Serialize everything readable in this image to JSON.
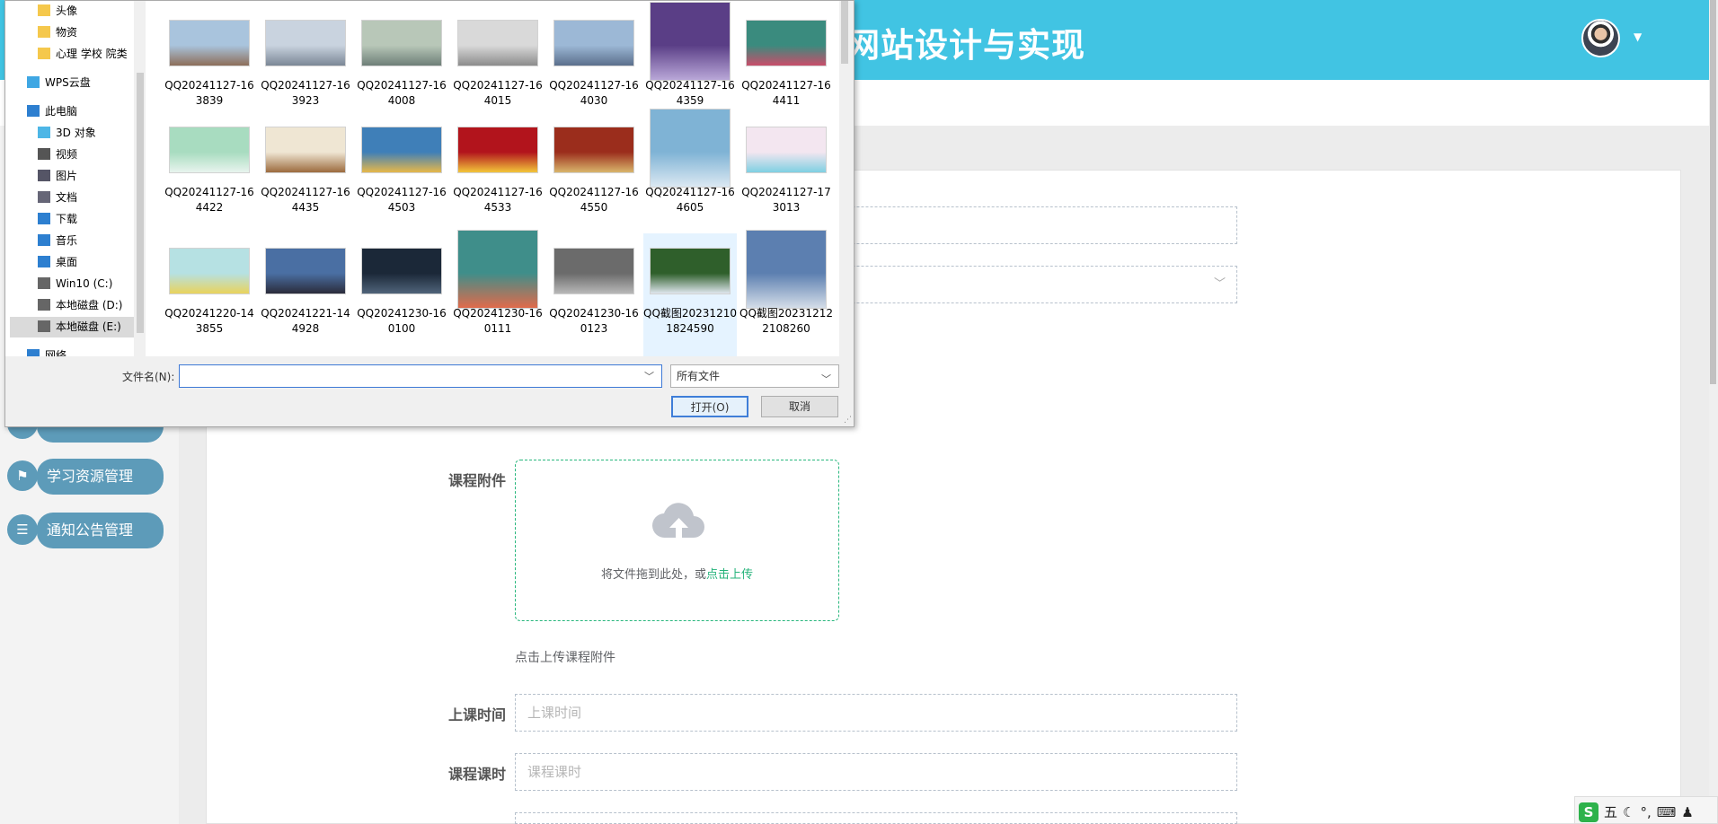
{
  "header": {
    "title": "网站设计与实现"
  },
  "sidebar": {
    "items": [
      {
        "label": "学习资源管理",
        "icon": "flag-icon"
      },
      {
        "label": "通知公告管理",
        "icon": "list-icon"
      }
    ]
  },
  "form": {
    "attachment_label": "课程附件",
    "upload_text": "将文件拖到此处，或",
    "upload_link": "点击上传",
    "upload_hint": "点击上传课程附件",
    "time_label": "上课时间",
    "time_placeholder": "上课时间",
    "hours_label": "课程课时",
    "hours_placeholder": "课程课时"
  },
  "dialog": {
    "nav": [
      {
        "label": "头像",
        "icon": "folder-icon"
      },
      {
        "label": "物资",
        "icon": "folder-icon"
      },
      {
        "label": "心理 学校 院类",
        "icon": "folder-icon"
      },
      {
        "label": "WPS云盘",
        "icon": "cloud-icon"
      },
      {
        "label": "此电脑",
        "icon": "computer-icon"
      },
      {
        "label": "3D 对象",
        "icon": "cube-icon"
      },
      {
        "label": "视频",
        "icon": "video-icon"
      },
      {
        "label": "图片",
        "icon": "picture-icon"
      },
      {
        "label": "文档",
        "icon": "document-icon"
      },
      {
        "label": "下载",
        "icon": "download-icon"
      },
      {
        "label": "音乐",
        "icon": "music-icon"
      },
      {
        "label": "桌面",
        "icon": "desktop-icon"
      },
      {
        "label": "Win10 (C:)",
        "icon": "drive-icon"
      },
      {
        "label": "本地磁盘 (D:)",
        "icon": "drive-icon"
      },
      {
        "label": "本地磁盘 (E:)",
        "icon": "drive-icon"
      },
      {
        "label": "网络",
        "icon": "network-icon"
      }
    ],
    "files": [
      "QQ20241127-163839",
      "QQ20241127-163923",
      "QQ20241127-164008",
      "QQ20241127-164015",
      "QQ20241127-164030",
      "QQ20241127-164359",
      "QQ20241127-164411",
      "QQ20241127-164422",
      "QQ20241127-164435",
      "QQ20241127-164503",
      "QQ20241127-164533",
      "QQ20241127-164550",
      "QQ20241127-164605",
      "QQ20241127-173013",
      "QQ20241220-143855",
      "QQ20241221-144928",
      "QQ20241230-160100",
      "QQ20241230-160111",
      "QQ20241230-160123",
      "QQ截图202312101824590",
      "QQ截图202312122108260"
    ],
    "thumb_colors": [
      [
        "#a9c4dd",
        "#8d6e5a"
      ],
      [
        "#c9d3df",
        "#7b8796"
      ],
      [
        "#b8c7b8",
        "#6e7f78"
      ],
      [
        "#d9d9d9",
        "#8c8c8c"
      ],
      [
        "#9cb8d6",
        "#5b6f8c"
      ],
      [
        "#5a3e86",
        "#b9a7d8"
      ],
      [
        "#3a8b7e",
        "#c94d6a"
      ],
      [
        "#a8dcc0",
        "#e8f4ee"
      ],
      [
        "#efe6d3",
        "#9c6b3e"
      ],
      [
        "#3f7fb8",
        "#e6b84a"
      ],
      [
        "#b2141c",
        "#f3c63a"
      ],
      [
        "#9b2d1c",
        "#d9b56c"
      ],
      [
        "#7fb3d5",
        "#dbe8f2"
      ],
      [
        "#f3e6f0",
        "#7fd0e2"
      ],
      [
        "#b6e1e3",
        "#e9d35c"
      ],
      [
        "#4a6fa3",
        "#2b2b3b"
      ],
      [
        "#1b2838",
        "#50647a"
      ],
      [
        "#3f8e8a",
        "#e06b4b"
      ],
      [
        "#6b6b6b",
        "#b8b8b8"
      ],
      [
        "#2f5f2b",
        "#dfe6ee"
      ],
      [
        "#5c7fb0",
        "#d4dde8"
      ]
    ],
    "filename_label": "文件名(N):",
    "filename_value": "",
    "type_value": "所有文件",
    "open_label": "打开(O)",
    "cancel_label": "取消"
  },
  "tray": {
    "ime_label": "五"
  }
}
